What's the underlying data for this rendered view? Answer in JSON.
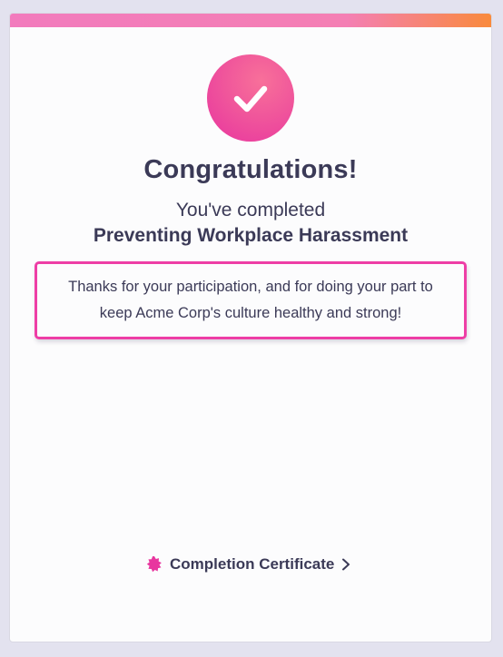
{
  "completion": {
    "title": "Congratulations!",
    "subtitle": "You've completed",
    "course_name": "Preventing Workplace Harassment",
    "message_line1": "Thanks for your participation, and for doing your part to",
    "message_line2": "keep Acme Corp's culture healthy and strong!",
    "icon": "checkmark-icon"
  },
  "certificate": {
    "label": "Completion Certificate",
    "icon": "badge-icon",
    "chevron": "chevron-right-icon"
  },
  "colors": {
    "accent": "#ee3ea6",
    "text": "#3b3a57",
    "stripe_start": "#f27bbd",
    "stripe_end": "#f98a3c",
    "background": "#e3e2ef"
  }
}
